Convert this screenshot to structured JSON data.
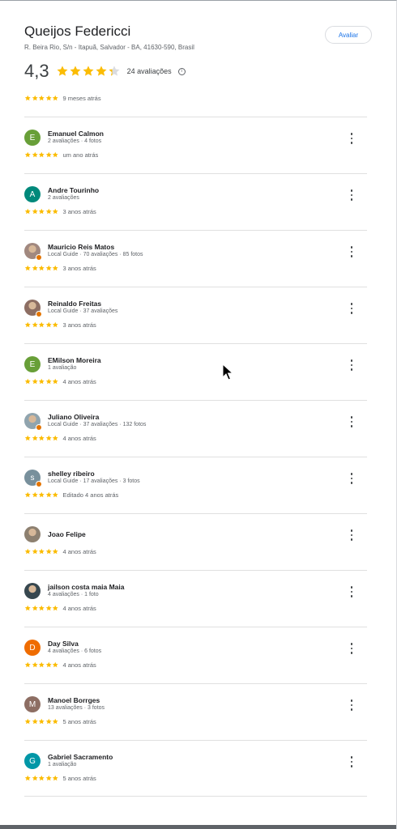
{
  "place": {
    "name": "Queijos Federicci",
    "address": "R. Beira Rio, S/n - Itapuã, Salvador - BA, 41630-590, Brasil",
    "write_review_label": "Avaliar",
    "rating": "4,3",
    "review_count": "24 avaliações",
    "info_symbol": "i"
  },
  "top_review": {
    "date": "9 meses atrás"
  },
  "colors": {
    "star": "#fbbc04",
    "accent": "#1a73e8"
  },
  "reviews": [
    {
      "name": "Emanuel Calmon",
      "meta": "2 avaliações · 4 fotos",
      "date": "um ano atrás",
      "initial": "E",
      "color": "#689f38",
      "photo": false,
      "guide": false
    },
    {
      "name": "Andre Tourinho",
      "meta": "2 avaliações",
      "date": "3 anos atrás",
      "initial": "A",
      "color": "#00897b",
      "photo": false,
      "guide": false
    },
    {
      "name": "Mauricio Reis Matos",
      "meta": "Local Guide · 70 avaliações · 85 fotos",
      "date": "3 anos atrás",
      "initial": "",
      "color": "#a1887f",
      "photo": true,
      "guide": true
    },
    {
      "name": "Reinaldo Freitas",
      "meta": "Local Guide · 37 avaliações",
      "date": "3 anos atrás",
      "initial": "",
      "color": "#8d6e63",
      "photo": true,
      "guide": true
    },
    {
      "name": "EMilson Moreira",
      "meta": "1 avaliação",
      "date": "4 anos atrás",
      "initial": "E",
      "color": "#689f38",
      "photo": false,
      "guide": false
    },
    {
      "name": "Juliano Oliveira",
      "meta": "Local Guide · 37 avaliações · 132 fotos",
      "date": "4 anos atrás",
      "initial": "",
      "color": "#90a4ae",
      "photo": true,
      "guide": true
    },
    {
      "name": "shelley ribeiro",
      "meta": "Local Guide · 17 avaliações · 3 fotos",
      "date": "Editado 4 anos atrás",
      "initial": "s",
      "color": "#78909c",
      "photo": false,
      "guide": true
    },
    {
      "name": "Joao Felipe",
      "meta": "",
      "date": "4 anos atrás",
      "initial": "",
      "color": "#8d8070",
      "photo": true,
      "guide": false
    },
    {
      "name": "jailson costa maia Maia",
      "meta": "4 avaliações · 1 foto",
      "date": "4 anos atrás",
      "initial": "",
      "color": "#37474f",
      "photo": true,
      "guide": false
    },
    {
      "name": "Day Silva",
      "meta": "4 avaliações · 6 fotos",
      "date": "4 anos atrás",
      "initial": "D",
      "color": "#ef6c00",
      "photo": false,
      "guide": false
    },
    {
      "name": "Manoel Borrges",
      "meta": "13 avaliações · 3 fotos",
      "date": "5 anos atrás",
      "initial": "M",
      "color": "#8d6e63",
      "photo": false,
      "guide": false
    },
    {
      "name": "Gabriel Sacramento",
      "meta": "1 avaliação",
      "date": "5 anos atrás",
      "initial": "G",
      "color": "#0097a7",
      "photo": false,
      "guide": false
    }
  ]
}
